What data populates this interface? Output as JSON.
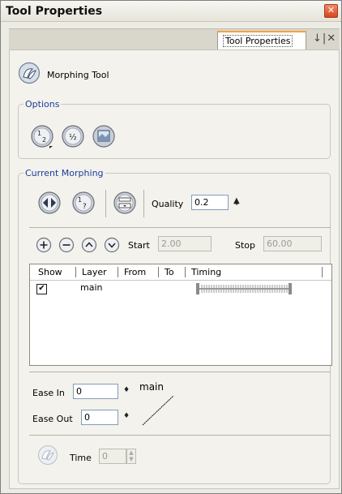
{
  "window": {
    "title": "Tool Properties"
  },
  "tab": {
    "label": "Tool Properties"
  },
  "tool": {
    "name": "Morphing Tool"
  },
  "options": {
    "legend": "Options"
  },
  "current_morphing": {
    "legend": "Current Morphing",
    "quality_label": "Quality",
    "quality_value": "0.2",
    "start_label": "Start",
    "start_value": "2.00",
    "stop_label": "Stop",
    "stop_value": "60.00"
  },
  "table": {
    "columns": [
      "Show",
      "Layer",
      "From",
      "To",
      "Timing"
    ],
    "rows": [
      {
        "show": true,
        "layer": "main",
        "from": "",
        "to": ""
      }
    ]
  },
  "ease": {
    "in_label": "Ease In",
    "in_value": "0",
    "out_label": "Ease Out",
    "out_value": "0",
    "curve_label": "main"
  },
  "time": {
    "label": "Time",
    "value": "0"
  },
  "icons": {
    "close": "close-icon",
    "tool": "morphing-tool-icon",
    "pin": "pin-icon",
    "detach": "detach-icon",
    "plus": "plus-icon",
    "minus": "minus-icon",
    "up": "chevron-up-icon",
    "down": "chevron-down-icon"
  },
  "colors": {
    "accent_tab": "#f2a341",
    "legend": "#1a3e9c",
    "close": "#d8461e"
  }
}
